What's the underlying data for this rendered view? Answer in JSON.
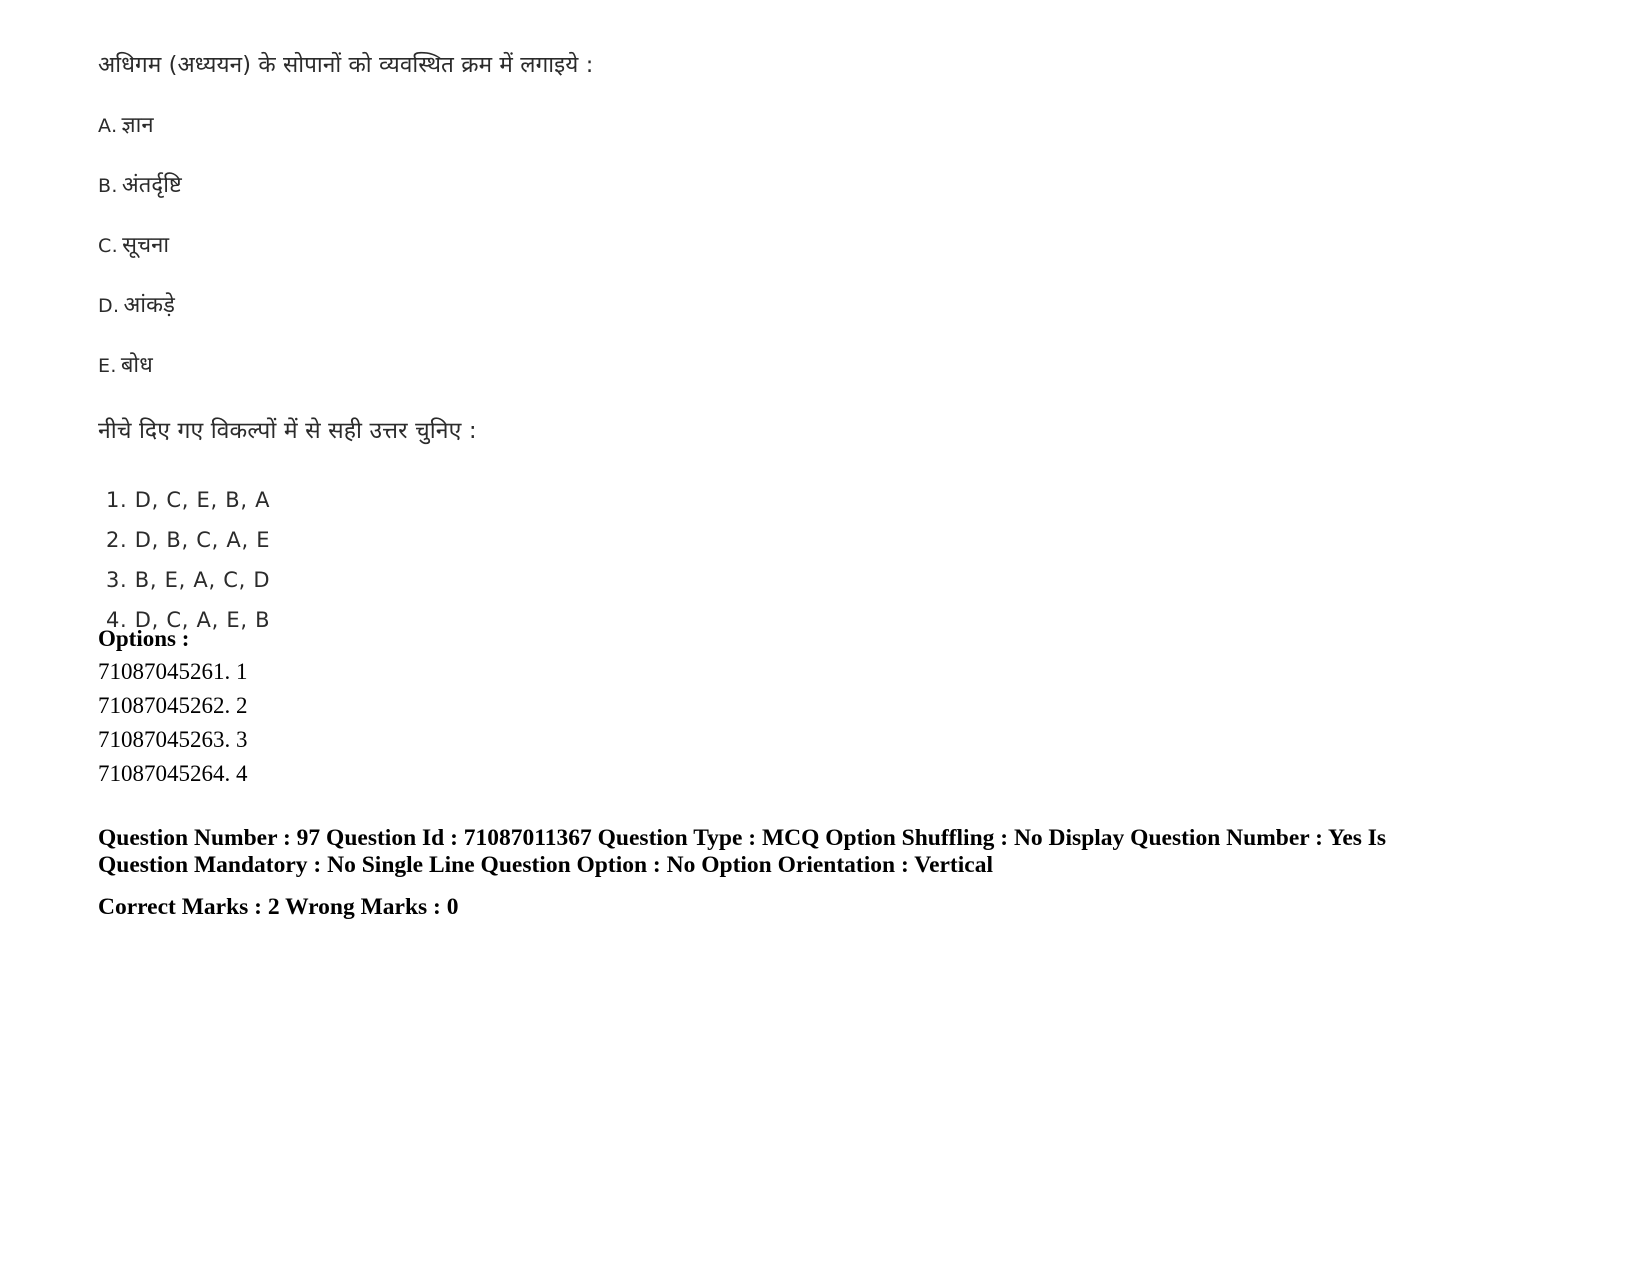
{
  "question": {
    "stem": "अधिगम (अध्ययन) के सोपानों को व्यवस्थित क्रम में लगाइये :",
    "items": [
      {
        "key": "A.",
        "text": "ज्ञान"
      },
      {
        "key": "B.",
        "text": "अंतर्दृष्टि"
      },
      {
        "key": "C.",
        "text": "सूचना"
      },
      {
        "key": "D.",
        "text": "आंकड़े"
      },
      {
        "key": "E.",
        "text": "बोध"
      }
    ],
    "choose_instruction": "नीचे दिए गए विकल्पों में से सही उत्तर चुनिए :",
    "alternatives": [
      "1. D, C, E, B, A",
      "2. D, B, C, A, E",
      "3. B, E, A, C, D",
      "4. D, C, A, E, B"
    ]
  },
  "options_section": {
    "heading": "Options :",
    "entries": [
      "71087045261. 1",
      "71087045262. 2",
      "71087045263. 3",
      "71087045264. 4"
    ]
  },
  "metadata": {
    "line1": "Question Number : 97 Question Id : 71087011367 Question Type : MCQ Option Shuffling : No Display Question Number : Yes Is",
    "line2": "Question Mandatory : No Single Line Question Option : No Option Orientation : Vertical",
    "line3": "Correct Marks : 2 Wrong Marks : 0",
    "question_number": "97",
    "question_id": "71087011367",
    "question_type": "MCQ",
    "option_shuffling": "No",
    "display_question_number": "Yes",
    "is_question_mandatory": "No",
    "single_line_question_option": "No",
    "option_orientation": "Vertical",
    "correct_marks": "2",
    "wrong_marks": "0"
  }
}
